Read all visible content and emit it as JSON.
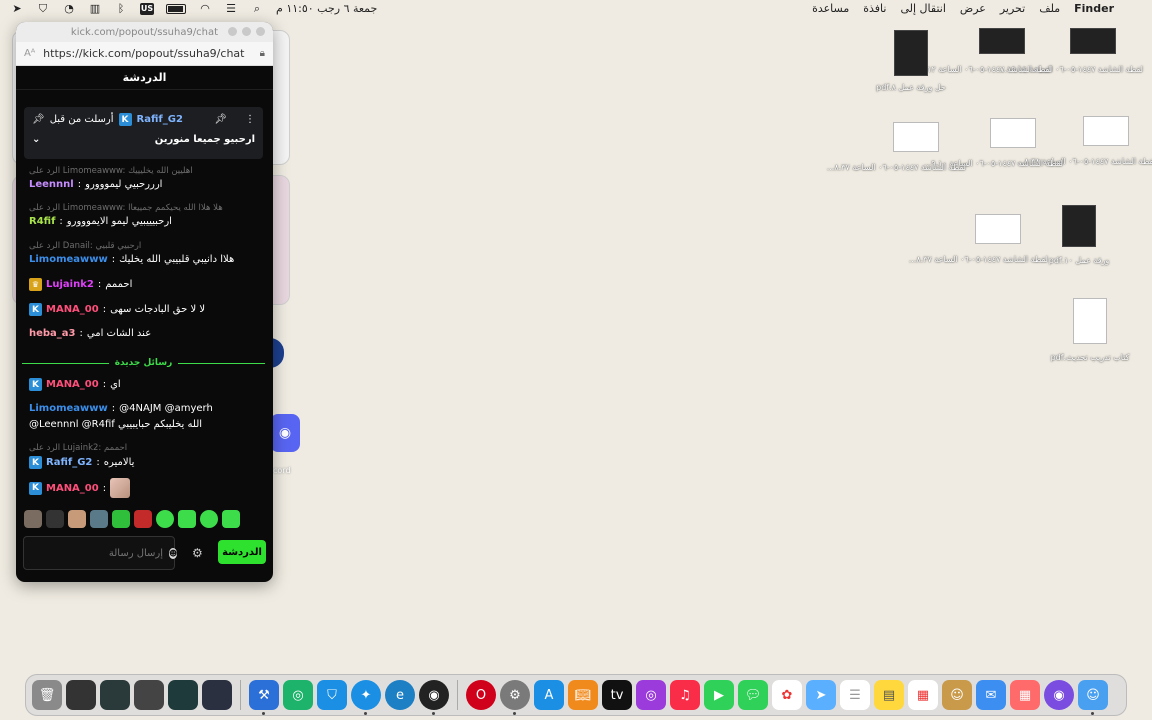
{
  "menubar": {
    "apple": "",
    "items": [
      "Finder",
      "ملف",
      "تحرير",
      "عرض",
      "انتقال إلى",
      "نافذة",
      "مساعدة"
    ],
    "clock": "جمعة ٦ رجب ١١:٥٠ م",
    "input_flag": "US"
  },
  "window": {
    "title": "kick.com/popout/ssuha9/chat",
    "url": "https://kick.com/popout/ssuha9/chat",
    "header": "الدردشة",
    "pinned": {
      "label": "أرسلت من قبل",
      "user": "Rafif_G2",
      "message": "ارحبيو جميعا منورين"
    },
    "messages": [
      {
        "reply": "الرد على Limomeawww: اهليين الله يخليييك",
        "user": "Leennnl",
        "user_color": "#c58dff",
        "text": "ارررحبيي ليمووورو"
      },
      {
        "reply": "الرد على Limomeawww: هلا هلاا الله يحيكمم جمييعاا",
        "user": "R4fif",
        "user_color": "#a9e34b",
        "text": "ارحبيييبيي ليمو الايمووورو"
      },
      {
        "reply": "الرد على Danail: ارحبيي قلبيي",
        "user": "Limomeawww",
        "user_color": "#3b8eea",
        "text": "هلاا دانيبي قلبيبي الله يخليك"
      },
      {
        "user": "Lujaink2",
        "user_color": "#e040fb",
        "text": "احممم"
      },
      {
        "user": "MANA_00",
        "user_color": "#ff4f7b",
        "text": "لا لا حق البادجات سهى"
      },
      {
        "user": "heba_a3",
        "user_color": "#ff9aa8",
        "text": "عند الشات امي"
      }
    ],
    "divider_label": "رسائل جديدة",
    "new_messages": [
      {
        "user": "MANA_00",
        "user_color": "#ff4f7b",
        "text": "اي"
      },
      {
        "user": "Limomeawww",
        "user_color": "#3b8eea",
        "text": "@4NAJM @amyerh",
        "text2": "@Leennnl @R4fif الله يخليبكم حبايبيبي"
      },
      {
        "reply": "الرد على Lujaink2: احممم",
        "user": "Rafif_G2",
        "user_color": "#7fb4ff",
        "text": "يالاميره"
      },
      {
        "user": "MANA_00",
        "user_color": "#ff4f7b",
        "text": ""
      }
    ],
    "composer_placeholder": "إرسال رسالة",
    "send_button": "الدردشة"
  },
  "background": {
    "discord_label": "cord"
  },
  "desktop_files": [
    {
      "label": "لقطة الشاشة ١٤٤٧-٠٥-٠٦ الساعة ١٩.١٤..."
    },
    {
      "label": "لقطة الشاشة ١٤٤٧-٠٥-٠٦ الساعة ٨.١٢..."
    },
    {
      "label": "حل ورقة عمل ٨.pdf"
    },
    {
      "label": "لقطة الشاشة ١٤٤٧-٠٥-٠٦ الساعة ٨.٣٨..."
    },
    {
      "label": "لقطة الشاشة ١٤٤٧-٠٥-٠٦ الساعة ٩.١٠..."
    },
    {
      "label": "لقطة الشاشة ١٤٤٧-٠٥-٠٦ الساعة ٨.٣٧..."
    },
    {
      "label": "ورقة عمل ١٠.pdf"
    },
    {
      "label": "لقطة الشاشة ١٤٤٧-٠٥-٠٦ الساعة ٨.٣٧..."
    },
    {
      "label": "كتاب تدريب تحديث.pdf"
    }
  ]
}
